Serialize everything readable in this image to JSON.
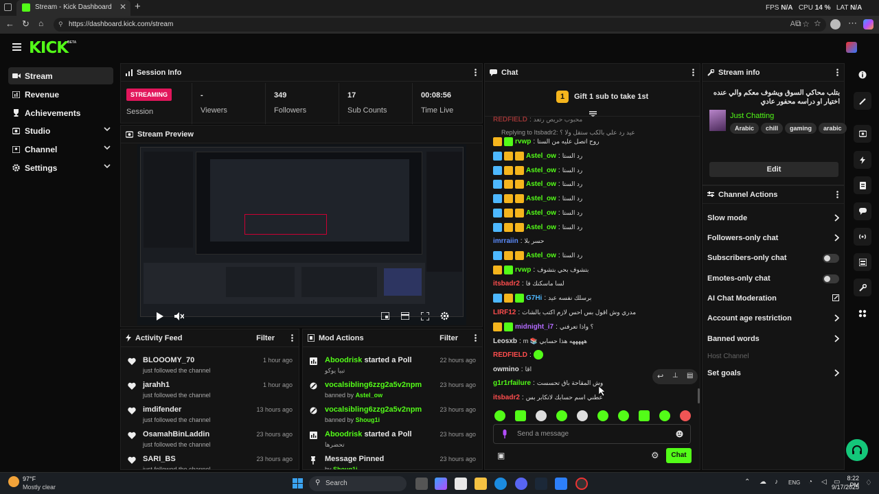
{
  "browser": {
    "tab_title": "Stream - Kick Dashboard",
    "url": "https://dashboard.kick.com/stream",
    "overlay": {
      "fps_label": "FPS",
      "fps_value": "N/A",
      "cpu_label": "CPU",
      "cpu_value": "14 %",
      "lat_label": "LAT",
      "lat_value": "N/A"
    }
  },
  "brand": {
    "logo": "KICK",
    "beta": "BETA",
    "accent": "#53fc18"
  },
  "sidebar": {
    "items": [
      {
        "label": "Stream",
        "icon": "video-icon",
        "active": true
      },
      {
        "label": "Revenue",
        "icon": "chart-icon"
      },
      {
        "label": "Achievements",
        "icon": "trophy-icon"
      },
      {
        "label": "Studio",
        "icon": "camera-icon"
      },
      {
        "label": "Channel",
        "icon": "user-icon"
      },
      {
        "label": "Settings",
        "icon": "gear-icon"
      }
    ]
  },
  "session": {
    "title": "Session Info",
    "status_badge": "STREAMING",
    "status_label": "Session",
    "stats": [
      {
        "value": "-",
        "label": "Viewers"
      },
      {
        "value": "349",
        "label": "Followers"
      },
      {
        "value": "17",
        "label": "Sub Counts"
      },
      {
        "value": "00:08:56",
        "label": "Time Live"
      }
    ]
  },
  "preview": {
    "title": "Stream Preview"
  },
  "activity": {
    "title": "Activity Feed",
    "filter": "Filter",
    "items": [
      {
        "name": "BLOOOMY_70",
        "sub": "just followed the channel",
        "time": "1 hour ago"
      },
      {
        "name": "jarahh1",
        "sub": "just followed the channel",
        "time": "1 hour ago"
      },
      {
        "name": "imdifender",
        "sub": "just followed the channel",
        "time": "13 hours ago"
      },
      {
        "name": "OsamahBinLaddin",
        "sub": "just followed the channel",
        "time": "23 hours ago"
      },
      {
        "name": "SARI_BS",
        "sub": "just followed the channel",
        "time": "23 hours ago"
      }
    ]
  },
  "mod": {
    "title": "Mod Actions",
    "filter": "Filter",
    "items": [
      {
        "user": "Aboodrisk",
        "action": "started a Poll",
        "sub": "تبيا يوكو",
        "time": "22 hours ago",
        "icon": "poll-icon"
      },
      {
        "user": "vocalsibling6zzg2a5v2npm",
        "action": "",
        "sub_prefix": "banned by",
        "sub_user": "Astel_ow",
        "time": "23 hours ago",
        "icon": "ban-icon"
      },
      {
        "user": "vocalsibling6zzg2a5v2npm",
        "action": "",
        "sub_prefix": "banned by",
        "sub_user": "Shoug1i",
        "time": "23 hours ago",
        "icon": "ban-icon"
      },
      {
        "user": "Aboodrisk",
        "action": "started a Poll",
        "sub": "تحضرها",
        "time": "23 hours ago",
        "icon": "poll-icon"
      },
      {
        "user": "",
        "action": "Message Pinned",
        "sub_prefix": "by",
        "sub_user": "Shoug1i",
        "time": "23 hours ago",
        "icon": "pin-icon"
      }
    ]
  },
  "chat": {
    "title": "Chat",
    "gift_banner": "Gift 1 sub to take 1st",
    "reply_note": "Replying to Itsbadr2: عيد رد علي بالكب ستقل ولا ؟",
    "messages": [
      {
        "user": "REDFIELD",
        "text": "محبوب حريص رتعد",
        "color": "#ff4d4d"
      },
      {
        "user": "rvwp",
        "text": "روح اتصل عليه من الستا",
        "color": "#53fc18"
      },
      {
        "user": "Astel_ow",
        "text": "رد الستا",
        "color": "#53fc18"
      },
      {
        "user": "Astel_ow",
        "text": "رد الستا",
        "color": "#53fc18"
      },
      {
        "user": "Astel_ow",
        "text": "رد الستا",
        "color": "#53fc18"
      },
      {
        "user": "Astel_ow",
        "text": "رد الستا",
        "color": "#53fc18"
      },
      {
        "user": "Astel_ow",
        "text": "رد الستا",
        "color": "#53fc18"
      },
      {
        "user": "Astel_ow",
        "text": "رد الستا",
        "color": "#53fc18"
      },
      {
        "user": "imrraiin",
        "text": "حسر بلا",
        "color": "#5b8cff"
      },
      {
        "user": "Astel_ow",
        "text": "رد الستا",
        "color": "#53fc18"
      },
      {
        "user": "rvwp",
        "text": "بتشوف بحي بتشوف",
        "color": "#53fc18"
      },
      {
        "user": "itsbadr2",
        "text": "لسا ماسكنك فا",
        "color": "#ff4d4d"
      },
      {
        "user": "G7Hi",
        "text": "برسلك نفسه عيد",
        "color": "#4db8ff"
      },
      {
        "user": "LIRF12",
        "text": "مدري وش اقول بس احس لازم اكتب بالشات",
        "color": "#ff4d4d"
      },
      {
        "user": "midnight_i7",
        "text": "؟ واذا تعرفني",
        "color": "#b36bff"
      },
      {
        "user": "Leosxb",
        "text": "m 📚 هههههه هذا حسابي",
        "color": "#dddddd"
      },
      {
        "user": "REDFIELD",
        "text": "",
        "color": "#ff4d4d"
      },
      {
        "user": "owmino",
        "text": "اقا",
        "color": "#dddddd"
      },
      {
        "user": "g1r1rfailure",
        "text": "وش المقاحة باق تحسست",
        "color": "#53fc18"
      },
      {
        "user": "itsbadr2",
        "text": "عطني اسم حسابك لاتكابر بس",
        "color": "#ff4d4d"
      }
    ],
    "input_placeholder": "Send a message",
    "send_label": "Chat"
  },
  "stream_info": {
    "title": "Stream info",
    "stream_title": "بتلب محاكي السوق ويشوف معكم والي عنده اختيار او دراسه محفور عادي",
    "category": "Just Chatting",
    "tags": [
      "Arabic",
      "chill",
      "gaming",
      "arabic"
    ],
    "edit_label": "Edit"
  },
  "channel_actions": {
    "title": "Channel Actions",
    "items": [
      {
        "label": "Slow mode",
        "control": "chevron"
      },
      {
        "label": "Followers-only chat",
        "control": "chevron"
      },
      {
        "label": "Subscribers-only chat",
        "control": "toggle"
      },
      {
        "label": "Emotes-only chat",
        "control": "toggle"
      },
      {
        "label": "AI Chat Moderation",
        "control": "external"
      },
      {
        "label": "Account age restriction",
        "control": "chevron"
      },
      {
        "label": "Banned words",
        "control": "chevron"
      },
      {
        "label": "Host Channel",
        "control": "none",
        "disabled": true
      },
      {
        "label": "Set goals",
        "control": "chevron"
      }
    ]
  },
  "taskbar": {
    "weather_temp": "97°F",
    "weather_desc": "Mostly clear",
    "search_placeholder": "Search",
    "lang": "ENG",
    "time": "8:22 PM",
    "date": "9/17/2025"
  }
}
